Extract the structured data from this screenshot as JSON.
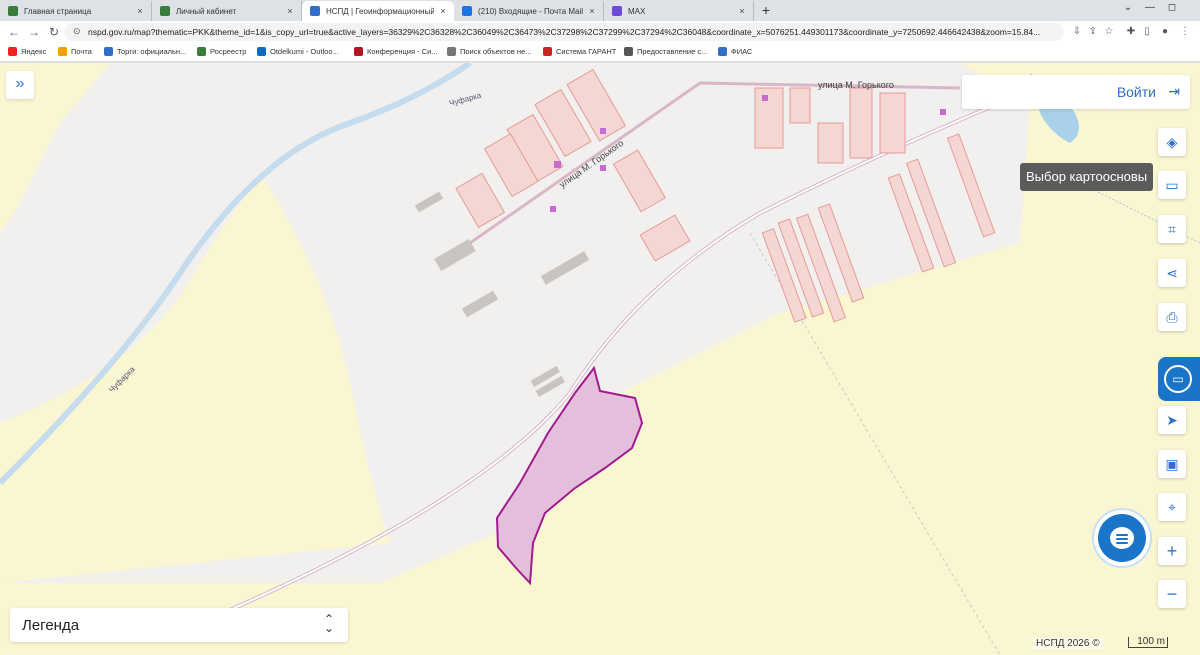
{
  "tabs": [
    {
      "title": "Главная страница",
      "favicon_color": "#3a7d3a"
    },
    {
      "title": "Личный кабинет",
      "favicon_color": "#3a7d3a"
    },
    {
      "title": "НСПД | Геоинформационный п",
      "favicon_color": "#2f6fc9"
    },
    {
      "title": "(210) Входящие - Почта Mail",
      "favicon_color": "#1a73e8"
    },
    {
      "title": "MAX",
      "favicon_color": "#6c4bd8"
    }
  ],
  "tab_close": "×",
  "new_tab": "+",
  "window": {
    "minimize": "⌄",
    "restore": "—",
    "maximize": "◻"
  },
  "nav": {
    "back": "←",
    "forward": "→",
    "reload": "↻"
  },
  "address": {
    "url": "nspd.gov.ru/map?thematic=PKK&theme_id=1&is_copy_url=true&active_layers=36329%2C36328%2C36049%2C36473%2C37298%2C37299%2C37294%2C36048&coordinate_x=5076251.449301173&coordinate_y=7250692.446642438&zoom=15.84..."
  },
  "bookmarks": [
    {
      "label": "Яндекс",
      "color": "#e22"
    },
    {
      "label": "Почта",
      "color": "#f2a200"
    },
    {
      "label": "Торги: официальн...",
      "color": "#2f6fc9"
    },
    {
      "label": "Росреестр",
      "color": "#3a7d3a"
    },
    {
      "label": "Otdelkumi - Outloo...",
      "color": "#0f6cbd"
    },
    {
      "label": "Конференция - Си...",
      "color": "#b12"
    },
    {
      "label": "Поиск объектов не...",
      "color": "#777"
    },
    {
      "label": "Система ГАРАНТ",
      "color": "#c22"
    },
    {
      "label": "Предоставление с...",
      "color": "#555"
    },
    {
      "label": "ФИАС",
      "color": "#2f6fc9"
    }
  ],
  "map": {
    "street_labels": [
      "улица М. Горького",
      "улица М. Горького",
      "Чуфарка",
      "Чуфарка"
    ],
    "login_label": "Войти",
    "tooltip": "Выбор картоосновы",
    "legend_label": "Легенда",
    "copyright": "НСПД 2026 ©",
    "scale_label": "100 m",
    "colors": {
      "background": "#fbf6d2",
      "settlement": "#f1f0ee",
      "parcel_fill": "#f4d6d2",
      "parcel_stroke": "#e69b95",
      "selected_parcel_fill": "#e4bfdc",
      "selected_parcel_stroke": "#a21a8f",
      "river": "#c4dced",
      "water": "#a9d1ea",
      "accent": "#2f6fc9"
    }
  },
  "icons": {
    "expand": "»",
    "login": "⇥",
    "layers": "◈",
    "ruler": "▭",
    "select": "⌗",
    "share": "⋖",
    "print": "⎙",
    "locate": "➤",
    "panel": "▣",
    "pin": "⌖",
    "zoom_in": "+",
    "zoom_out": "−",
    "legend_toggle": "⌃⌄"
  }
}
